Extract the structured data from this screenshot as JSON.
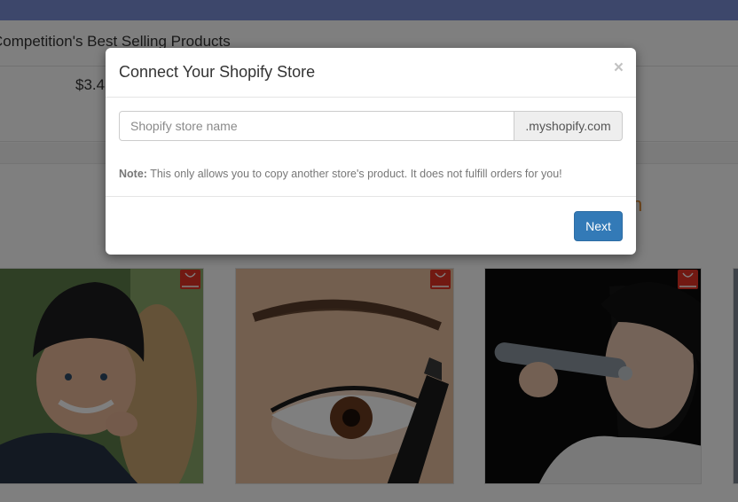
{
  "background": {
    "section_title": "Competition's Best Selling Products",
    "price": "$3.4",
    "products": [
      {
        "name": "Woman in black knit beanie with ponytail",
        "store_icon": "aliexpress-icon"
      },
      {
        "name": "Eyebrow microblading tattoo pen close-up",
        "store_icon": "aliexpress-icon"
      },
      {
        "name": "Woman using facial massage roller",
        "store_icon": "aliexpress-icon"
      },
      {
        "name": "Partial product card",
        "store_icon": ""
      }
    ]
  },
  "modal": {
    "title": "Connect Your Shopify Store",
    "close_label": "×",
    "input_placeholder": "Shopify store name",
    "input_value": "",
    "addon_text": ".myshopify.com",
    "note_label": "Note:",
    "note_text": " This only allows you to copy another store's product. It does not fulfill orders for you!",
    "next_label": "Next"
  },
  "colors": {
    "topbar": "#7a8fd6",
    "primary_button": "#337ab7",
    "aliexpress_badge": "#e43225",
    "overlay": "rgba(0,0,0,0.5)"
  }
}
